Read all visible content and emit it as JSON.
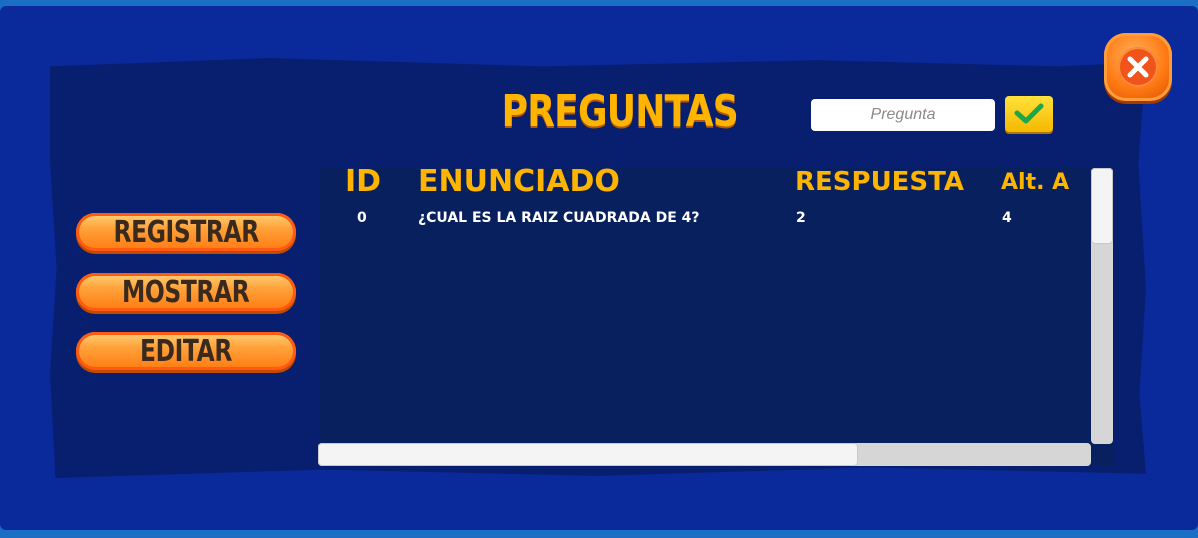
{
  "header": {
    "title": "PREGUNTAS",
    "search_placeholder": "Pregunta"
  },
  "sidebar": {
    "buttons": [
      "REGISTRAR",
      "MOSTRAR",
      "EDITAR"
    ]
  },
  "table": {
    "columns": [
      "ID",
      "ENUNCIADO",
      "RESPUESTA",
      "Alt. A"
    ],
    "rows": [
      [
        "0",
        "¿CUAL ES LA RAIZ CUADRADA DE 4?",
        "2",
        "4"
      ]
    ]
  },
  "icons": {
    "close": "close-x-icon",
    "confirm": "checkmark-icon"
  },
  "colors": {
    "frame": "#0a2a9c",
    "panel": "#071f6e",
    "accent": "#ffb400",
    "button": "#ff8a1f"
  }
}
